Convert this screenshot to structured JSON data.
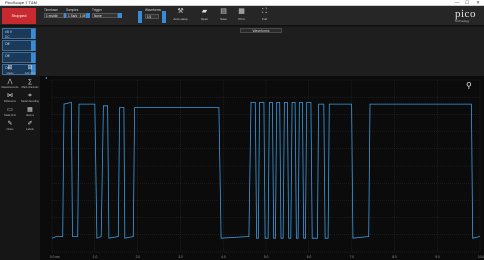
{
  "window": {
    "title": "PicoScope 7 T&M",
    "minimize": "—",
    "maximize": "☐",
    "close": "✕"
  },
  "toolbar": {
    "stop_label": "Stopped",
    "timebase": {
      "label": "Timebase",
      "value": "1 ms/div"
    },
    "samples": {
      "label": "Samples",
      "value": "1 Sa/s · 1 MS"
    },
    "trigger": {
      "label": "Trigger",
      "value": "None"
    },
    "waveforms": {
      "label": "Waveforms",
      "current": "1/1"
    },
    "buttons": [
      {
        "name": "autosetup-button",
        "icon": "wand-icon",
        "glyph": "⚒",
        "label": "Auto setup"
      },
      {
        "name": "open-button",
        "icon": "folder-icon",
        "glyph": "▰",
        "label": "Open"
      },
      {
        "name": "save-button",
        "icon": "floppy-icon",
        "glyph": "▤",
        "label": "Save"
      },
      {
        "name": "print-button",
        "icon": "printer-icon",
        "glyph": "▦",
        "label": "Print"
      },
      {
        "name": "fullscreen-button",
        "icon": "expand-icon",
        "glyph": "⛶",
        "label": "Full"
      }
    ],
    "logo": {
      "text": "pico",
      "subtitle": "Technology"
    }
  },
  "channels": [
    {
      "id": "A",
      "value": "±5 V",
      "sub": "DC"
    },
    {
      "id": "B",
      "value": "Off",
      "sub": ""
    },
    {
      "id": "C",
      "value": "Off",
      "sub": ""
    },
    {
      "id": "D",
      "value": "Off",
      "sub": ""
    }
  ],
  "waveform_tab": "Waveforms",
  "tools": [
    {
      "name": "tool-views",
      "icon": "grid-icon",
      "glyph": "⊞",
      "label": "Views"
    },
    {
      "name": "tool-add-view",
      "icon": "add-grid-icon",
      "glyph": "⊞",
      "label": "Add view"
    },
    {
      "name": "tool-measurements",
      "icon": "measure-icon",
      "glyph": "⋀",
      "label": "Measurements"
    },
    {
      "name": "tool-math",
      "icon": "math-icon",
      "glyph": "∑",
      "label": "Math channels"
    },
    {
      "name": "tool-reference",
      "icon": "reference-icon",
      "glyph": "⋈",
      "label": "Reference"
    },
    {
      "name": "tool-serial",
      "icon": "serial-icon",
      "glyph": "⌗",
      "label": "Serial decoding"
    },
    {
      "name": "tool-mask",
      "icon": "mask-icon",
      "glyph": "▭",
      "label": "Mask limit"
    },
    {
      "name": "tool-alarms",
      "icon": "alarm-icon",
      "glyph": "▦",
      "label": "Alarms"
    },
    {
      "name": "tool-notes",
      "icon": "pencil-icon",
      "glyph": "✎",
      "label": "Notes"
    },
    {
      "name": "tool-more",
      "icon": "edit-icon",
      "glyph": "✐",
      "label": "Labels"
    }
  ],
  "scope": {
    "trace_color": "#3d9be0",
    "grid_color": "#2c2c2c",
    "y_ticks": [
      "",
      "",
      "",
      "",
      "",
      "",
      "",
      "",
      "",
      "",
      ""
    ],
    "x_ticks": [
      "0.0 ms",
      "1.0",
      "2.0",
      "3.0",
      "4.0",
      "5.0",
      "6.0",
      "7.0",
      "8.0",
      "9.0",
      "10.0"
    ]
  },
  "chart_data": {
    "type": "line",
    "x_unit": "ms",
    "xlim": [
      0,
      10
    ],
    "ylim": [
      0,
      10
    ],
    "series": [
      {
        "values_xy": [
          [
            0,
            0.8
          ],
          [
            0.1,
            0.9
          ],
          [
            0.25,
            0.9
          ],
          [
            0.28,
            8.6
          ],
          [
            0.45,
            8.7
          ],
          [
            0.48,
            0.9
          ],
          [
            0.6,
            0.9
          ],
          [
            0.63,
            8.6
          ],
          [
            1.0,
            8.6
          ],
          [
            1.05,
            0.8
          ],
          [
            1.15,
            0.9
          ],
          [
            1.2,
            8.5
          ],
          [
            1.3,
            8.5
          ],
          [
            1.33,
            0.8
          ],
          [
            1.55,
            0.9
          ],
          [
            1.58,
            8.4
          ],
          [
            1.68,
            8.4
          ],
          [
            1.7,
            0.8
          ],
          [
            1.9,
            0.9
          ],
          [
            1.93,
            8.4
          ],
          [
            3.9,
            8.4
          ],
          [
            3.95,
            0.8
          ],
          [
            4.6,
            0.9
          ],
          [
            4.65,
            8.7
          ],
          [
            4.75,
            8.7
          ],
          [
            4.78,
            0.8
          ],
          [
            4.82,
            0.8
          ],
          [
            4.85,
            8.7
          ],
          [
            4.95,
            8.7
          ],
          [
            4.98,
            0.8
          ],
          [
            5.05,
            0.8
          ],
          [
            5.08,
            8.7
          ],
          [
            5.15,
            8.7
          ],
          [
            5.18,
            0.8
          ],
          [
            5.22,
            0.8
          ],
          [
            5.25,
            8.7
          ],
          [
            5.32,
            8.7
          ],
          [
            5.35,
            0.8
          ],
          [
            5.4,
            0.8
          ],
          [
            5.43,
            8.7
          ],
          [
            5.5,
            8.7
          ],
          [
            5.53,
            0.8
          ],
          [
            5.58,
            0.8
          ],
          [
            5.61,
            8.7
          ],
          [
            5.68,
            8.7
          ],
          [
            5.71,
            0.8
          ],
          [
            5.75,
            0.8
          ],
          [
            5.78,
            8.7
          ],
          [
            5.85,
            8.7
          ],
          [
            5.88,
            0.8
          ],
          [
            5.92,
            0.8
          ],
          [
            5.95,
            8.7
          ],
          [
            6.05,
            8.7
          ],
          [
            6.08,
            0.8
          ],
          [
            6.2,
            0.8
          ],
          [
            6.23,
            8.6
          ],
          [
            6.35,
            8.6
          ],
          [
            6.38,
            0.8
          ],
          [
            6.45,
            0.8
          ],
          [
            6.48,
            8.6
          ],
          [
            7.0,
            8.6
          ],
          [
            7.03,
            0.8
          ],
          [
            7.4,
            0.9
          ],
          [
            7.43,
            8.6
          ],
          [
            9.8,
            8.6
          ],
          [
            9.83,
            0.8
          ],
          [
            10,
            0.9
          ]
        ]
      }
    ]
  }
}
